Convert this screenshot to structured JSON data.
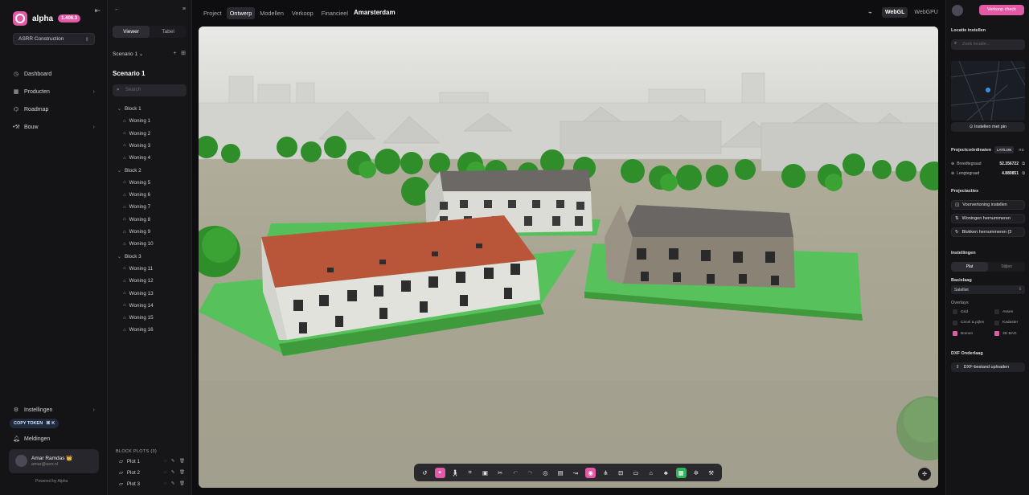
{
  "nav": {
    "brand": "alpha",
    "version": "1.406.3",
    "organization": "ASRR Construction",
    "items": [
      {
        "label": "Dashboard",
        "icon": "dashboard-icon"
      },
      {
        "label": "Producten",
        "icon": "grid-icon"
      },
      {
        "label": "Roadmap",
        "icon": "roadmap-icon"
      },
      {
        "label": "Bouw",
        "icon": "construction-icon"
      }
    ],
    "settings_label": "Instellingen",
    "copy_token_label": "COPY TOKEN",
    "notifications_label": "Meldingen",
    "user": {
      "name": "Amar Ramdas 👑",
      "email": "amar@asrr.nl"
    },
    "powered_by": "Powered by Alpha"
  },
  "panel": {
    "view_tabs": [
      "Viewer",
      "Tabel"
    ],
    "scenario_select": "Scenario 1",
    "scenario_title": "Scenario 1",
    "search_placeholder": "Search",
    "blocks": [
      {
        "name": "Block 1",
        "items": [
          "Woning 1",
          "Woning 2",
          "Woning 3",
          "Woning 4"
        ]
      },
      {
        "name": "Block 2",
        "items": [
          "Woning 5",
          "Woning 6",
          "Woning 7",
          "Woning 8",
          "Woning 9",
          "Woning 10"
        ]
      },
      {
        "name": "Block 3",
        "items": [
          "Woning 11",
          "Woning 12",
          "Woning 13",
          "Woning 14",
          "Woning 15",
          "Woning 16"
        ]
      }
    ],
    "plots_header": "BLOCK PLOTS (3)",
    "plots": [
      "Plot 1",
      "Plot 2",
      "Plot 3"
    ]
  },
  "topbar": {
    "tabs": [
      "Project",
      "Ontwerp",
      "Modellen",
      "Verkoop",
      "Financieel"
    ],
    "active_tab": "Ontwerp",
    "city": "Amarsterdam",
    "renderers": [
      "WebGL",
      "WebGPU"
    ],
    "active_renderer": "WebGL"
  },
  "right": {
    "buy_label": "Verkoop check",
    "location_header": "Locatie instellen",
    "location_search_placeholder": "Zoek locatie...",
    "pin_label": "Instellen met pin",
    "coords_header": "Projectcoördinaten",
    "coord_modes": [
      "LAT/LON",
      "RD"
    ],
    "latitude_label": "Breedtegraad",
    "latitude_value": "52.356722",
    "longitude_label": "Lengtegraad",
    "longitude_value": "4.880851",
    "actions_header": "Projectacties",
    "actions": [
      "Voorvertoning instellen",
      "Woningen hernummeren",
      "Blokken hernummeren (3"
    ],
    "settings_header": "Instellingen",
    "style_tabs": [
      "Plat",
      "Stijlen"
    ],
    "basemap_header": "Basislaag",
    "basemap_value": "Satelliet",
    "overlays_header": "Overlays",
    "overlays": [
      {
        "label": "Grid",
        "checked": false
      },
      {
        "label": "Assen",
        "checked": false
      },
      {
        "label": "Circel & pijlen",
        "checked": false
      },
      {
        "label": "Kadaster",
        "checked": false
      },
      {
        "label": "Bomen",
        "checked": true
      },
      {
        "label": "3D BAG",
        "checked": true
      }
    ],
    "dxf_header": "DXF Onderlaag",
    "dxf_upload_label": "DXF-bestand uploaden"
  },
  "colors": {
    "accent": "#e25aa5",
    "active_green": "#2fb35a"
  }
}
